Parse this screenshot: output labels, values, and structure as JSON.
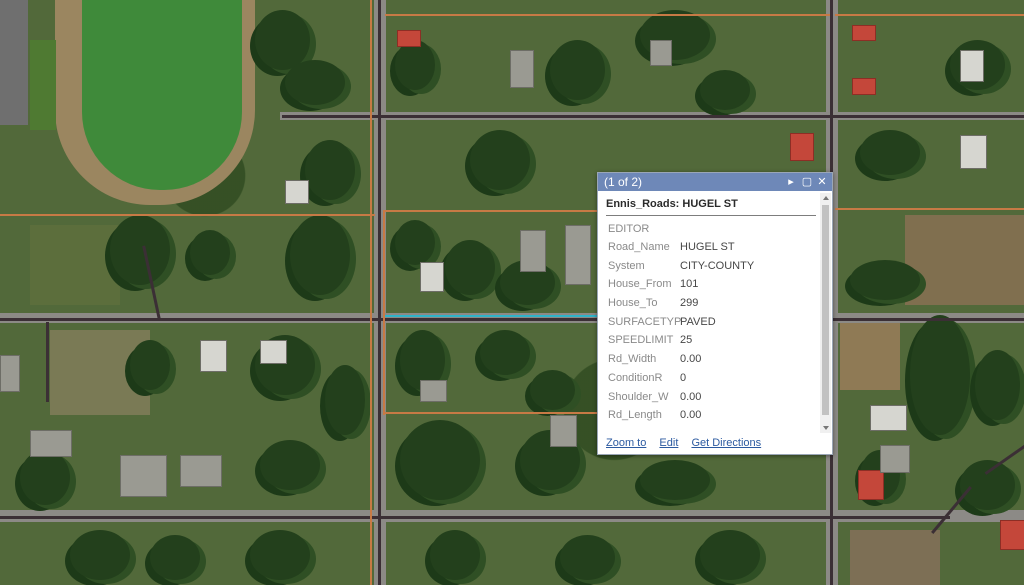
{
  "popup": {
    "counter": "(1 of 2)",
    "title": "Ennis_Roads: HUGEL ST",
    "section": "EDITOR",
    "fields": [
      {
        "key": "Road_Name",
        "value": "HUGEL ST"
      },
      {
        "key": "System",
        "value": "CITY-COUNTY"
      },
      {
        "key": "House_From",
        "value": "101"
      },
      {
        "key": "House_To",
        "value": "299"
      },
      {
        "key": "SURFACETYP",
        "value": "PAVED"
      },
      {
        "key": "SPEEDLIMIT",
        "value": "25"
      },
      {
        "key": "Rd_Width",
        "value": "0.00"
      },
      {
        "key": "ConditionR",
        "value": "0"
      },
      {
        "key": "Shoulder_W",
        "value": "0.00"
      },
      {
        "key": "Rd_Length",
        "value": "0.00"
      }
    ],
    "actions": {
      "zoom": "Zoom to",
      "edit": "Edit",
      "directions": "Get Directions"
    },
    "icons": {
      "next": "▸",
      "maximize": "▢",
      "close": "✕"
    }
  },
  "colors": {
    "popup_header": "#6e88b8",
    "selected_road": "#2fb3c9",
    "road_line": "#3b2f35",
    "parcel_line": "#c77a45"
  }
}
